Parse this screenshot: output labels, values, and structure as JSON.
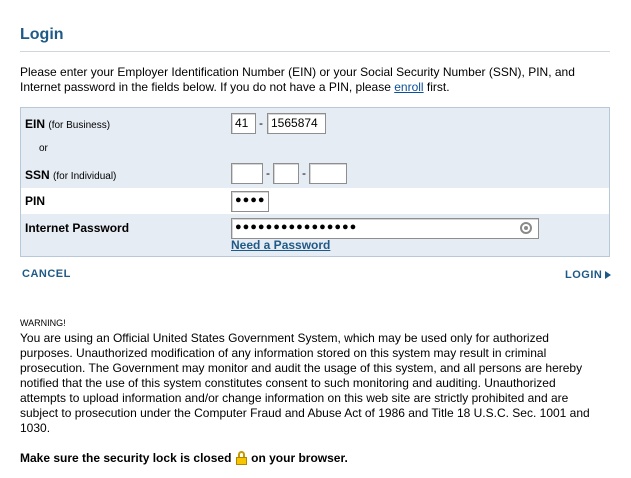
{
  "page": {
    "title": "Login"
  },
  "intro": {
    "text_before": "Please enter your Employer Identification Number (EIN) or your Social Security Number (SSN), PIN, and Internet password in the fields below. If you do not have a PIN, please ",
    "enroll_link": "enroll",
    "text_after": " first."
  },
  "form": {
    "ein": {
      "label": "EIN",
      "sublabel": "(for Business)",
      "part1": "41",
      "separator": "-",
      "part2": "1565874"
    },
    "or_text": "or",
    "ssn": {
      "label": "SSN",
      "sublabel": "(for Individual)",
      "part1": "",
      "part2": "",
      "part3": "",
      "separator": "-"
    },
    "pin": {
      "label": "PIN",
      "masked_value": "●●●●"
    },
    "password": {
      "label": "Internet Password",
      "masked_value": "●●●●●●●●●●●●●●●●",
      "reveal_icon": "eye-icon"
    },
    "need_password_link": "Need a Password"
  },
  "actions": {
    "cancel_label": "CANCEL",
    "login_label": "LOGIN"
  },
  "warning": {
    "heading": "WARNING!",
    "body": "You are using an Official United States Government System, which may be used only for authorized purposes. Unauthorized modification of any information stored on this system may result in criminal prosecution. The Government may monitor and audit the usage of this system, and all persons are hereby notified that the use of this system constitutes consent to such monitoring and auditing. Unauthorized attempts to upload information and/or change information on this web site are strictly prohibited and are subject to prosecution under the Computer Fraud and Abuse Act of 1986 and Title 18 U.S.C. Sec. 1001 and 1030.",
    "lock_before": "Make sure the security lock is closed",
    "lock_icon": "padlock-icon",
    "lock_after": "on your browser."
  },
  "colors": {
    "accent": "#1f5a86",
    "form_bg": "#e6ecf4",
    "form_border": "#b9c8d8"
  }
}
